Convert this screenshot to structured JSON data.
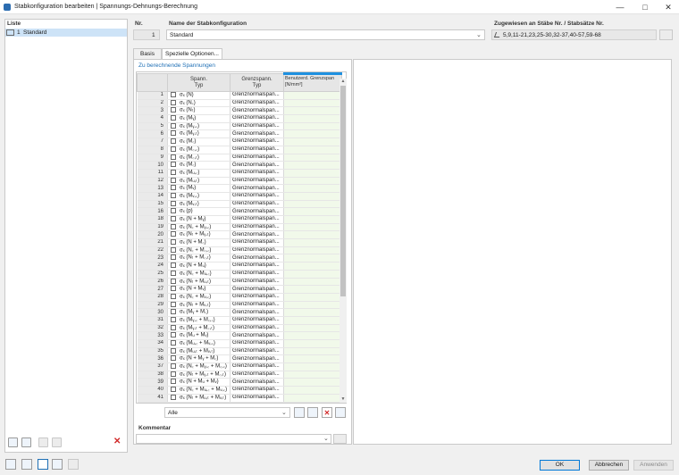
{
  "window": {
    "title": "Stabkonfiguration bearbeiten | Spannungs-Dehnungs-Berechnung"
  },
  "list": {
    "label": "Liste",
    "items": [
      {
        "number": "1",
        "name": "Standard"
      }
    ]
  },
  "header": {
    "nr_label": "Nr.",
    "nr_value": "1",
    "name_label": "Name der Stabkonfiguration",
    "name_value": "Standard",
    "assign_label": "Zugewiesen an Stäbe Nr. / Stabsätze Nr.",
    "assign_value": "5,9,11-21,23,25-30,32-37,40-57,59-68"
  },
  "tabs": [
    {
      "label": "Basis"
    },
    {
      "label": "Spezielle Optionen..."
    }
  ],
  "section": {
    "label": "Zu berechnende Spannungen"
  },
  "grid": {
    "headers": {
      "stress": "Spann.\nTyp",
      "limit": "Grenzspann.\nTyp",
      "user": "Benutzerd. Grenzspan\n[N/mm²]"
    },
    "limit_value": "Grenznormalspan...",
    "rows": [
      {
        "n": "1",
        "type": "σₓ (N)"
      },
      {
        "n": "2",
        "type": "σₓ (N꜀)"
      },
      {
        "n": "3",
        "type": "σₓ (Nₜ)"
      },
      {
        "n": "4",
        "type": "σₓ (Mᵧ)"
      },
      {
        "n": "5",
        "type": "σₓ (Mᵧ,꜀)"
      },
      {
        "n": "6",
        "type": "σₓ (Mᵧ,ₜ)"
      },
      {
        "n": "7",
        "type": "σₓ (M꜀)"
      },
      {
        "n": "8",
        "type": "σₓ (M꜀,꜀)"
      },
      {
        "n": "9",
        "type": "σₓ (M꜀,ₜ)"
      },
      {
        "n": "10",
        "type": "σₓ (M꜀)"
      },
      {
        "n": "11",
        "type": "σₓ (Mᵤ,꜀)"
      },
      {
        "n": "12",
        "type": "σₓ (Mᵤ,ₜ)"
      },
      {
        "n": "13",
        "type": "σₓ (Mᵥ)"
      },
      {
        "n": "14",
        "type": "σₓ (Mᵥ,꜀)"
      },
      {
        "n": "15",
        "type": "σₓ (Mᵥ,ₜ)"
      },
      {
        "n": "16",
        "type": "σₓ (p)"
      },
      {
        "n": "18",
        "type": "σₓ (N + Mᵧ)"
      },
      {
        "n": "19",
        "type": "σₓ (N꜀ + Mᵧ,꜀)"
      },
      {
        "n": "20",
        "type": "σₓ (Nₜ + Mᵧ,ₜ)"
      },
      {
        "n": "21",
        "type": "σₓ (N + M꜀)"
      },
      {
        "n": "22",
        "type": "σₓ (N꜀ + M꜀,꜀)"
      },
      {
        "n": "23",
        "type": "σₓ (Nₜ + M꜀,ₜ)"
      },
      {
        "n": "24",
        "type": "σₓ (N + Mᵤ)"
      },
      {
        "n": "25",
        "type": "σₓ (N꜀ + Mᵤ,꜀)"
      },
      {
        "n": "26",
        "type": "σₓ (Nₜ + Mᵤ,ₜ)"
      },
      {
        "n": "27",
        "type": "σₓ (N + Mᵥ)"
      },
      {
        "n": "28",
        "type": "σₓ (N꜀ + Mᵥ,꜀)"
      },
      {
        "n": "29",
        "type": "σₓ (Nₜ + Mᵥ,ₜ)"
      },
      {
        "n": "30",
        "type": "σₓ (Mᵧ + M꜀)"
      },
      {
        "n": "31",
        "type": "σₓ (Mᵧ,꜀ + M꜀,꜀)"
      },
      {
        "n": "32",
        "type": "σₓ (Mᵧ,ₜ + M꜀,ₜ)"
      },
      {
        "n": "33",
        "type": "σₓ (Mᵤ + Mᵥ)"
      },
      {
        "n": "34",
        "type": "σₓ (Mᵤ,꜀ + Mᵥ,꜀)"
      },
      {
        "n": "35",
        "type": "σₓ (Mᵤ,ₜ + Mᵥ,ₜ)"
      },
      {
        "n": "36",
        "type": "σₓ (N + Mᵧ + M꜀)"
      },
      {
        "n": "37",
        "type": "σₓ (N꜀ + Mᵧ,꜀ + M꜀,꜀)"
      },
      {
        "n": "38",
        "type": "σₓ (Nₜ + Mᵧ,ₜ + M꜀,ₜ)"
      },
      {
        "n": "39",
        "type": "σₓ (N + Mᵤ + Mᵥ)"
      },
      {
        "n": "40",
        "type": "σₓ (N꜀ + Mᵤ,꜀ + Mᵥ,꜀)"
      },
      {
        "n": "41",
        "type": "σₓ (Nₜ + Mᵤ,ₜ + Mᵥ,ₜ)"
      }
    ]
  },
  "filter": {
    "value": "Alle"
  },
  "comment": {
    "label": "Kommentar"
  },
  "buttons": {
    "ok": "OK",
    "cancel": "Abbrechen",
    "apply": "Anwenden"
  },
  "colors": {
    "accent": "#1e90e0",
    "selection": "#cde3f7",
    "delete": "#d12a2a"
  }
}
